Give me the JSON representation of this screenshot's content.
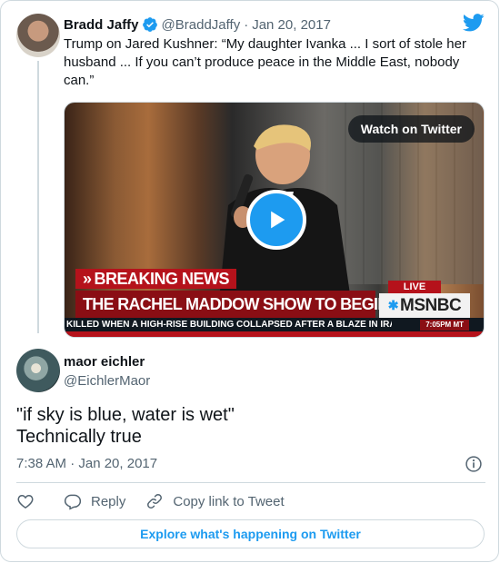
{
  "parent_tweet": {
    "author_name": "Bradd Jaffy",
    "author_handle": "@BraddJaffy",
    "separator": "·",
    "date": "Jan 20, 2017",
    "text": "Trump on Jared Kushner: “My daughter Ivanka ... I sort of stole her husband ... If you can’t produce peace in the Middle East, nobody can.”",
    "verified": true,
    "video": {
      "watch_label": "Watch on Twitter",
      "breaking_label": "BREAKING NEWS",
      "headline": "THE RACHEL MADDOW SHOW TO BEGIN SHORTLY",
      "live_label": "LIVE",
      "network": "MSNBC",
      "ticker": "KILLED WHEN A HIGH-RISE BUILDING COLLAPSED AFTER A BLAZE IN IRAN'S C",
      "ticker_time": "7:05PM MT"
    }
  },
  "main_tweet": {
    "author_name": "maor eichler",
    "author_handle": "@EichlerMaor",
    "text_line1": "\"if sky is blue, water is wet\"",
    "text_line2": "Technically true",
    "timestamp": "7:38 AM · Jan 20, 2017"
  },
  "actions": {
    "reply_label": "Reply",
    "copy_label": "Copy link to Tweet"
  },
  "explore_label": "Explore what's happening on Twitter",
  "colors": {
    "twitter_blue": "#1d9bf0",
    "text_primary": "#0f1419",
    "text_secondary": "#536471",
    "border": "#cfd9de",
    "msnbc_red": "#b5121b"
  },
  "icons": [
    "verified-badge-icon",
    "twitter-bird-icon",
    "play-icon",
    "info-icon",
    "heart-icon",
    "reply-icon",
    "link-icon"
  ]
}
